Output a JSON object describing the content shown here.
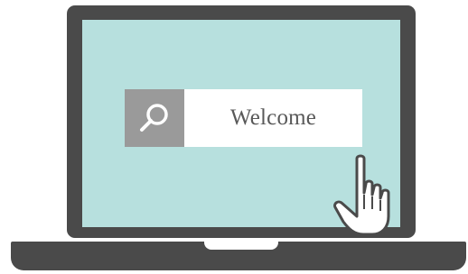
{
  "search": {
    "icon": "search-icon",
    "value": "Welcome"
  },
  "cursor": {
    "icon": "pointer-hand-icon"
  },
  "colors": {
    "bezel": "#4a4a4a",
    "screen": "#b7e0de",
    "search_icon_bg": "#9a9a9a",
    "search_field_bg": "#ffffff",
    "search_text": "#595959"
  }
}
